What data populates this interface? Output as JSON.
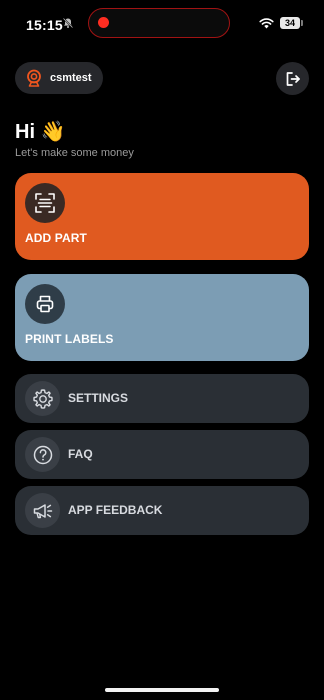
{
  "status_bar": {
    "time": "15:15",
    "battery": "34",
    "icons": [
      "silent-icon",
      "recording-dot",
      "wifi-icon",
      "battery-icon"
    ]
  },
  "header": {
    "username": "csmtest",
    "avatar_icon": "webcam-icon",
    "logout_icon": "logout-icon"
  },
  "greeting": {
    "title": "Hi 👋",
    "subtitle": "Let's make some money"
  },
  "actions": [
    {
      "label": "ADD PART",
      "icon": "scan-icon",
      "color": "#e05a20"
    },
    {
      "label": "PRINT LABELS",
      "icon": "printer-icon",
      "color": "#7c9db4"
    }
  ],
  "menu": [
    {
      "label": "SETTINGS",
      "icon": "gear-icon"
    },
    {
      "label": "FAQ",
      "icon": "question-icon"
    },
    {
      "label": "APP FEEDBACK",
      "icon": "megaphone-icon"
    }
  ],
  "colors": {
    "background": "#000000",
    "accent": "#e05a20",
    "print_card": "#7c9db4",
    "menu_row": "#2a2f35",
    "recording": "#ff2d21"
  }
}
